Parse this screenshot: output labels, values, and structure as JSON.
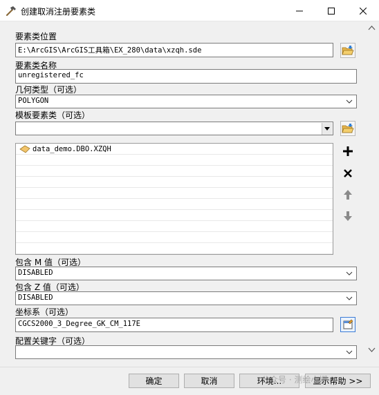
{
  "window": {
    "title": "创建取消注册要素类"
  },
  "fields": {
    "location_label": "要素类位置",
    "location_value": "E:\\ArcGIS\\ArcGIS工具箱\\EX_280\\data\\xzqh.sde",
    "name_label": "要素类名称",
    "name_value": "unregistered_fc",
    "geometry_label": "几何类型（可选）",
    "geometry_value": "POLYGON",
    "template_label": "模板要素类（可选）",
    "template_value": "",
    "template_list": [
      "data_demo.DBO.XZQH"
    ],
    "has_m_label": "包含 M 值（可选）",
    "has_m_value": "DISABLED",
    "has_z_label": "包含 Z 值（可选）",
    "has_z_value": "DISABLED",
    "spatial_ref_label": "坐标系（可选）",
    "spatial_ref_value": "CGCS2000_3_Degree_GK_CM_117E",
    "config_keyword_label": "配置关键字（可选）",
    "config_keyword_value": ""
  },
  "buttons": {
    "ok": "确定",
    "cancel": "取消",
    "environments": "环境...",
    "show_help": "显示帮助 >>"
  },
  "watermark": "公众号 · 测绘小娜"
}
